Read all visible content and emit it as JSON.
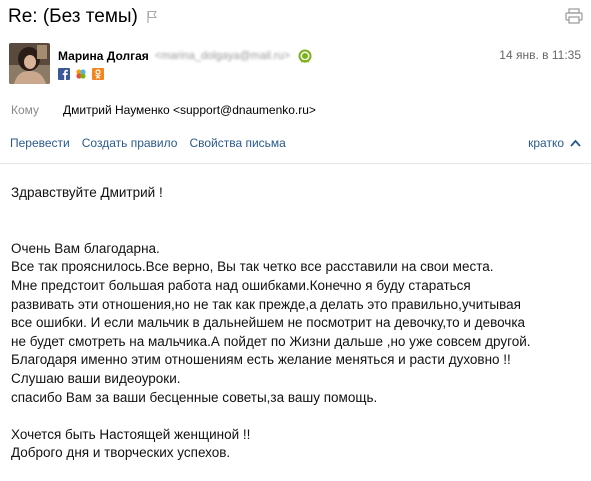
{
  "header": {
    "subject": "Re: (Без темы)",
    "flag_icon": "flag-icon",
    "print_icon": "print-icon"
  },
  "sender": {
    "name": "Марина Долгая",
    "email": "<marina_dolgaya@mail.ru>",
    "date": "14 янв. в 11:35",
    "social_icons": [
      "facebook-icon",
      "mail-agent-icon",
      "odnoklassniki-icon"
    ],
    "verified_icon": "verified-icon"
  },
  "recipient": {
    "label": "Кому",
    "value": "Дмитрий Науменко <support@dnaumenko.ru>"
  },
  "actions": {
    "translate": "Перевести",
    "create_rule": "Создать правило",
    "properties": "Свойства письма",
    "brief": "кратко"
  },
  "message": {
    "greeting": "Здравствуйте Дмитрий !",
    "lines": [
      "Очень Вам благодарна.",
      "Все так прояснилось.Все верно, Вы так четко все расставили на свои места.",
      "Мне предстоит большая работа над ошибками.Конечно я буду стараться",
      "развивать эти отношения,но не так как прежде,а делать это правильно,учитывая",
      "все ошибки. И если мальчик в дальнейшем не посмотрит на девочку,то и девочка",
      "не будет смотреть на мальчика.А пойдет по Жизни дальше ,но уже совсем другой.",
      "Благодаря именно этим отношениям есть желание меняться и расти духовно !!",
      "Слушаю ваши видеоуроки.",
      "спасибо Вам за ваши бесценные советы,за вашу помощь."
    ],
    "closing": [
      "Хочется быть Настоящей женщиной !!",
      "Доброго дня и творческих успехов."
    ]
  },
  "colors": {
    "link": "#2a5a8c",
    "muted": "#8a8a8a",
    "verified": "#7ab317"
  }
}
